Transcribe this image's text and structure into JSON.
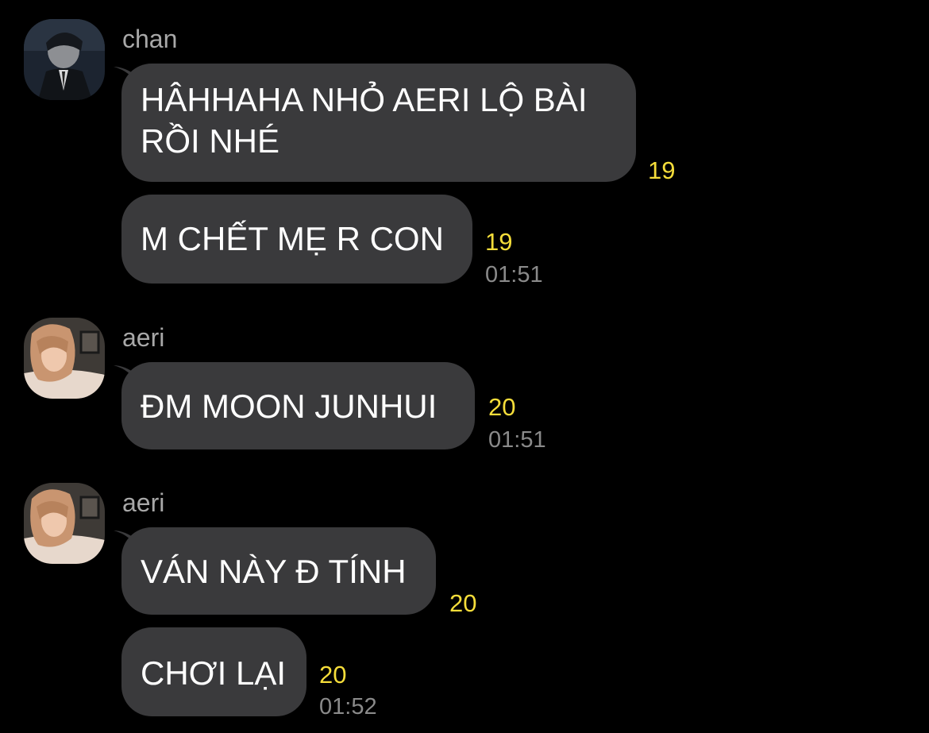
{
  "accent_colors": {
    "bubble": "#3a3a3c",
    "unread_count": "#f5dd3a",
    "background": "#000000"
  },
  "messages": [
    {
      "sender": "chan",
      "avatar": "avatar-chan-icon",
      "text": "HÂHHAHA NHỎ AERI LỘ BÀI RỒI NHÉ",
      "unread": "19"
    },
    {
      "text": "M CHẾT MẸ R CON",
      "unread": "19",
      "time": "01:51"
    },
    {
      "sender": "aeri",
      "avatar": "avatar-aeri-icon",
      "text": "ĐM MOON JUNHUI",
      "unread": "20",
      "time": "01:51"
    },
    {
      "sender": "aeri",
      "avatar": "avatar-aeri-icon",
      "text": "VÁN NÀY Đ TÍNH",
      "unread": "20"
    },
    {
      "text": "CHƠI LẠI",
      "unread": "20",
      "time": "01:52"
    }
  ]
}
